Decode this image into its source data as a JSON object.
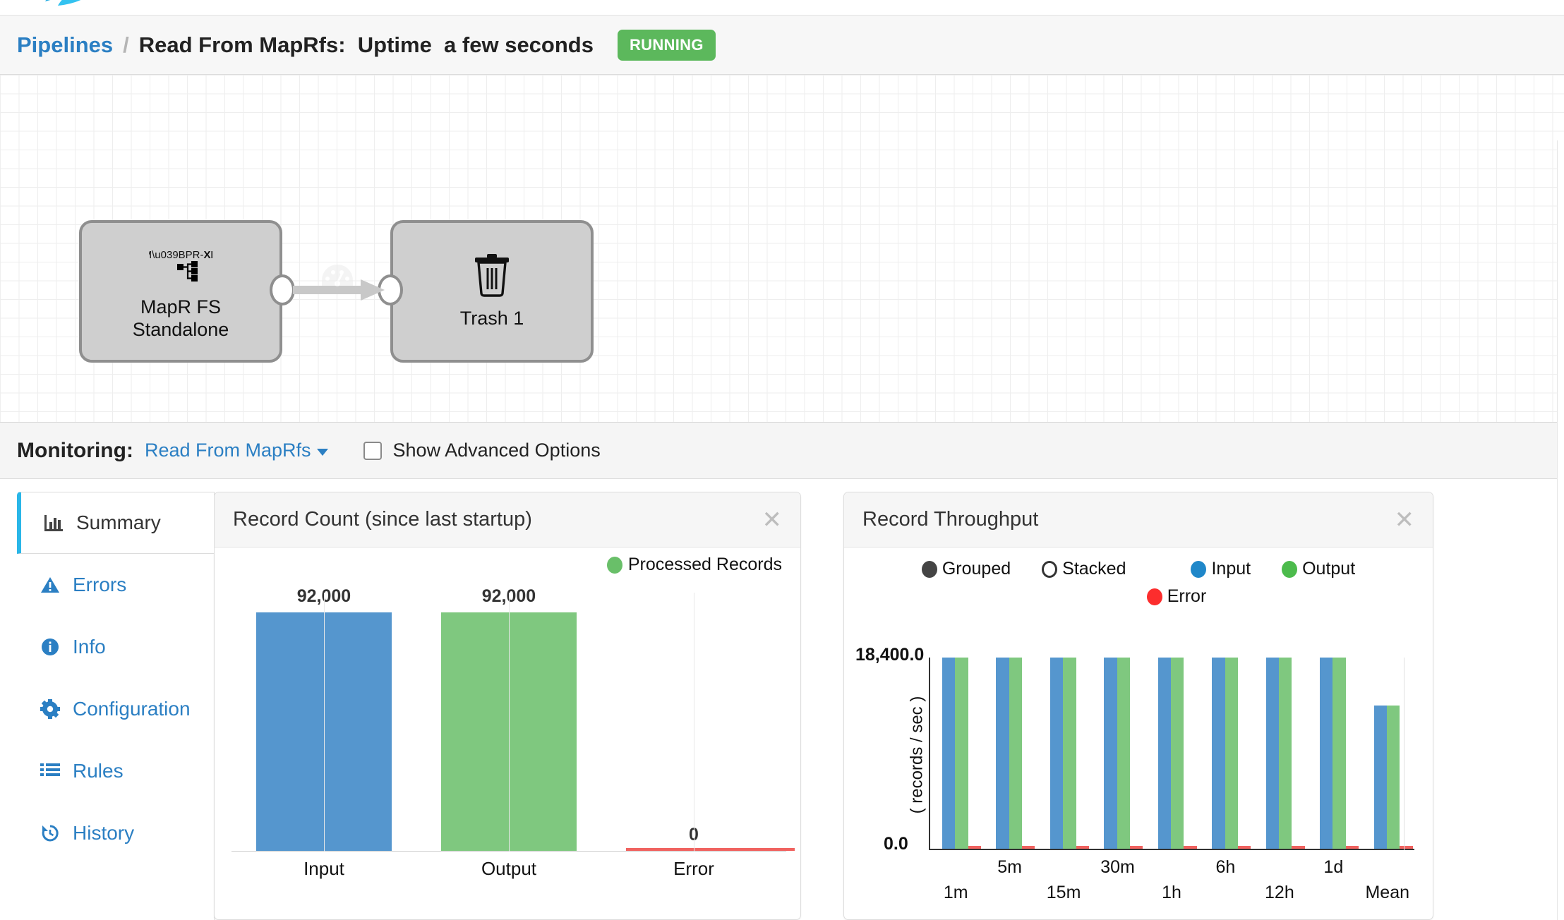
{
  "brand": {
    "logo_icon": "streamsets-logo-icon",
    "accent": "#29b6e8"
  },
  "breadcrumb": {
    "root_label": "Pipelines",
    "separator": "/",
    "title": "Read From MapRfs:  Uptime  a few seconds",
    "status": "RUNNING",
    "status_color": "#5cb85c"
  },
  "canvas": {
    "stages": [
      {
        "label_line1": "MapR FS",
        "label_line2": "Standalone",
        "icon": "mapr-xd-icon",
        "logo_text": "MAPR-XD"
      },
      {
        "label_line1": "Trash 1",
        "label_line2": "",
        "icon": "trash-icon"
      }
    ]
  },
  "monitoring": {
    "label": "Monitoring:",
    "selected_pipeline": "Read From MapRfs",
    "advanced_options_label": "Show Advanced Options",
    "advanced_options_checked": false
  },
  "tabs": [
    {
      "label": "Summary",
      "icon": "bar-chart-icon",
      "active": true
    },
    {
      "label": "Errors",
      "icon": "warning-triangle-icon",
      "active": false
    },
    {
      "label": "Info",
      "icon": "info-circle-icon",
      "active": false
    },
    {
      "label": "Configuration",
      "icon": "gear-icon",
      "active": false
    },
    {
      "label": "Rules",
      "icon": "list-icon",
      "active": false
    },
    {
      "label": "History",
      "icon": "history-clock-icon",
      "active": false
    }
  ],
  "cards": {
    "record_count": {
      "title": "Record Count (since last startup)",
      "close_label": "✕"
    },
    "record_throughput": {
      "title": "Record Throughput",
      "close_label": "✕"
    }
  },
  "chart_data": [
    {
      "id": "record-count",
      "type": "bar",
      "title": "Record Count (since last startup)",
      "categories": [
        "Input",
        "Output",
        "Error"
      ],
      "values": [
        92000,
        92000,
        0
      ],
      "value_labels": [
        "92,000",
        "92,000",
        "0"
      ],
      "colors": [
        "#5596ce",
        "#7fc87f",
        "#f0625f"
      ],
      "legend": [
        {
          "label": "Processed Records",
          "color": "#69bf69"
        }
      ],
      "legend_position": "top-right",
      "xlabel": "",
      "ylabel": "",
      "ylim": [
        0,
        100000
      ],
      "grid": false
    },
    {
      "id": "record-throughput",
      "type": "bar",
      "title": "Record Throughput",
      "mode_options": [
        {
          "label": "Grouped",
          "selected": true,
          "color": "#444444"
        },
        {
          "label": "Stacked",
          "selected": false,
          "color": "#444444"
        }
      ],
      "categories": [
        "1m",
        "5m",
        "15m",
        "30m",
        "1h",
        "6h",
        "12h",
        "1d",
        "Mean"
      ],
      "series": [
        {
          "name": "Input",
          "color": "#1f87c9",
          "bar_color": "#5596ce",
          "values": [
            18400,
            18400,
            18400,
            18400,
            18400,
            18400,
            18400,
            18400,
            13800
          ]
        },
        {
          "name": "Output",
          "color": "#4cbb4c",
          "bar_color": "#7fc87f",
          "values": [
            18400,
            18400,
            18400,
            18400,
            18400,
            18400,
            18400,
            18400,
            13800
          ]
        },
        {
          "name": "Error",
          "color": "#fc2d2d",
          "bar_color": "#f0625f",
          "values": [
            0,
            0,
            0,
            0,
            0,
            0,
            0,
            0,
            0
          ]
        }
      ],
      "ylabel": "( records / sec )",
      "ytick_labels": [
        "18,400.0",
        "0.0"
      ],
      "ylim": [
        0,
        18400
      ],
      "xlabel": "",
      "legend_position": "top",
      "grid": false
    }
  ]
}
